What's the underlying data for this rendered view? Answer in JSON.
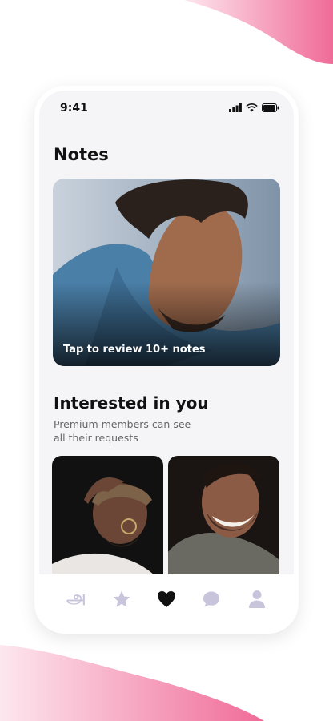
{
  "status": {
    "time": "9:41"
  },
  "notes": {
    "title": "Notes",
    "cta": "Tap to review 10+ notes"
  },
  "interested": {
    "title": "Interested in you",
    "subtitle_line1": "Premium members can see",
    "subtitle_line2": "all their requests"
  },
  "tabbar": {
    "discover_glyph": "அ",
    "active_tab": "likes"
  },
  "colors": {
    "accent_pink": "#f06b98",
    "tab_inactive": "#c8c4dc",
    "tab_active": "#111111"
  }
}
